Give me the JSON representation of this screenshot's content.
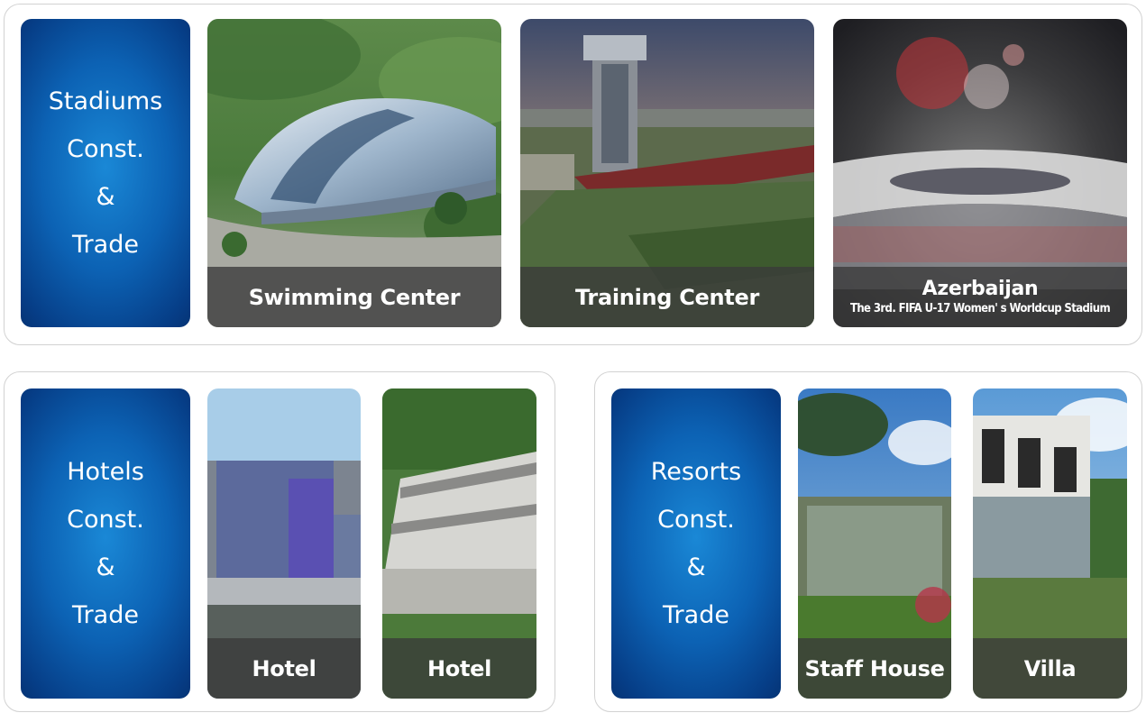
{
  "sections": [
    {
      "label_lines": [
        "Stadiums",
        "Const.",
        "&",
        "Trade"
      ],
      "tiles": [
        {
          "caption": "Swimming Center"
        },
        {
          "caption": "Training Center"
        },
        {
          "caption": "Azerbaijan",
          "subcaption": "The 3rd. FIFA U-17 Women' s Worldcup Stadium"
        }
      ]
    },
    {
      "label_lines": [
        "Hotels",
        "Const.",
        "&",
        "Trade"
      ],
      "tiles": [
        {
          "caption": "Hotel"
        },
        {
          "caption": "Hotel"
        }
      ]
    },
    {
      "label_lines": [
        "Resorts",
        "Const.",
        "&",
        "Trade"
      ],
      "tiles": [
        {
          "caption": "Staff House"
        },
        {
          "caption": "Villa"
        }
      ]
    }
  ],
  "colors": {
    "label_card_blue": "#0c62b4",
    "caption_bar": "#3a3a3a",
    "panel_border": "#d2d2d2"
  }
}
